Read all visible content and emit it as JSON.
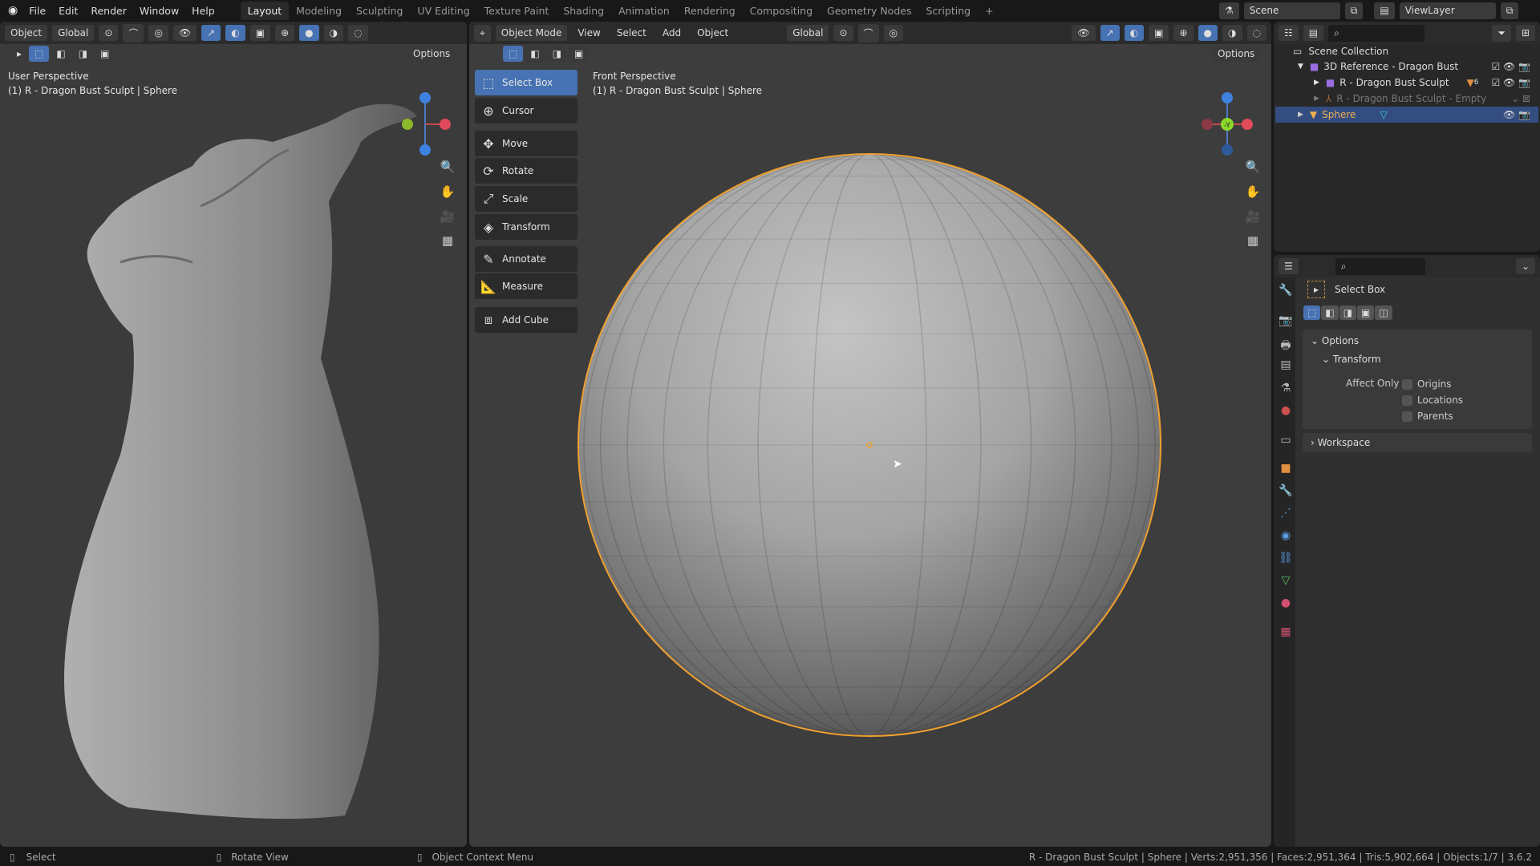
{
  "menu": [
    "File",
    "Edit",
    "Render",
    "Window",
    "Help"
  ],
  "workspaces": [
    "Layout",
    "Modeling",
    "Sculpting",
    "UV Editing",
    "Texture Paint",
    "Shading",
    "Animation",
    "Rendering",
    "Compositing",
    "Geometry Nodes",
    "Scripting",
    "+"
  ],
  "scene": {
    "name": "Scene",
    "view_layer": "ViewLayer"
  },
  "left_viewport": {
    "mode_label": "Object",
    "orientation": "Global",
    "options": "Options",
    "view_name": "User Perspective",
    "object_info": "(1) R - Dragon Bust Sculpt | Sphere"
  },
  "main_viewport": {
    "mode": "Object Mode",
    "menus": [
      "View",
      "Select",
      "Add",
      "Object"
    ],
    "orientation": "Global",
    "options": "Options",
    "view_name": "Front Perspective",
    "object_info": "(1) R - Dragon Bust Sculpt | Sphere",
    "gizmo_label": "-Y"
  },
  "toolbar": [
    {
      "label": "Select Box",
      "icon": "select-box-icon",
      "active": true
    },
    {
      "label": "Cursor",
      "icon": "cursor-icon"
    },
    {
      "label": "Move",
      "icon": "move-icon"
    },
    {
      "label": "Rotate",
      "icon": "rotate-icon"
    },
    {
      "label": "Scale",
      "icon": "scale-icon"
    },
    {
      "label": "Transform",
      "icon": "transform-icon"
    },
    {
      "label": "Annotate",
      "icon": "annotate-icon"
    },
    {
      "label": "Measure",
      "icon": "measure-icon"
    },
    {
      "label": "Add Cube",
      "icon": "add-cube-icon"
    }
  ],
  "outliner": {
    "root": "Scene Collection",
    "items": [
      {
        "label": "3D Reference - Dragon Bust",
        "type": "collection"
      },
      {
        "label": "R - Dragon Bust Sculpt",
        "type": "collection",
        "badge": "6"
      },
      {
        "label": "R - Dragon Bust Sculpt - Empty",
        "type": "empty"
      },
      {
        "label": "Sphere",
        "type": "mesh",
        "selected": true
      }
    ]
  },
  "properties": {
    "tool_name": "Select Box",
    "options": "Options",
    "transform": "Transform",
    "affect_only": "Affect Only",
    "checkboxes": [
      {
        "label": "Origins",
        "checked": false
      },
      {
        "label": "Locations",
        "checked": false
      },
      {
        "label": "Parents",
        "checked": false
      }
    ],
    "workspace": "Workspace"
  },
  "status": {
    "hints": [
      "Select",
      "Rotate View",
      "Object Context Menu"
    ],
    "stats": "R - Dragon Bust Sculpt | Sphere | Verts:2,951,356 | Faces:2,951,364 | Tris:5,902,664 | Objects:1/7 | 3.6.2"
  },
  "colors": {
    "accent": "#4772b3",
    "selection": "#f0a030",
    "background": "#3d3d3d"
  }
}
